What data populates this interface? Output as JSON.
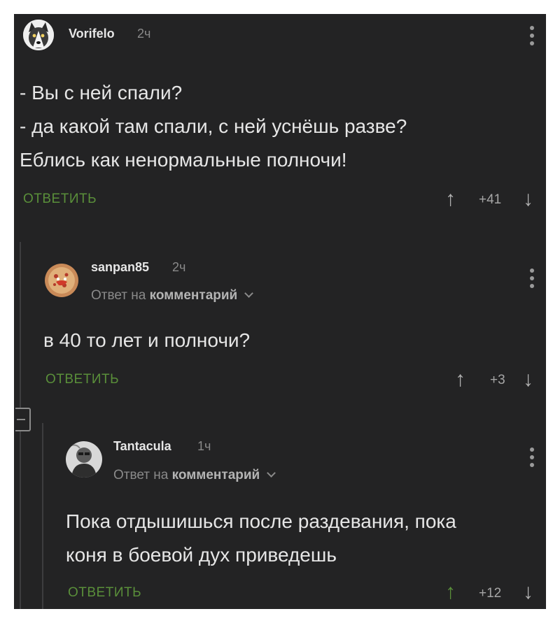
{
  "comments": [
    {
      "username": "Vorifelo",
      "time": "2ч",
      "lines": [
        "- Вы с ней спали?",
        "- да какой там спали, с ней уснёшь разве?",
        "Еблись как ненормальные полночи!"
      ],
      "reply_label": "ОТВЕТИТЬ",
      "score": "+41",
      "avatar_icon": "husky-avatar-icon"
    },
    {
      "username": "sanpan85",
      "time": "2ч",
      "reply_to_prefix": "Ответ на",
      "reply_to_target": "комментарий",
      "lines": [
        "в 40 то лет и полночи?"
      ],
      "reply_label": "ОТВЕТИТЬ",
      "score": "+3",
      "avatar_icon": "pizza-avatar-icon"
    },
    {
      "username": "Tantacula",
      "time": "1ч",
      "reply_to_prefix": "Ответ на",
      "reply_to_target": "комментарий",
      "lines": [
        "Пока отдышишься после раздевания, пока",
        "коня в боевой дух приведешь"
      ],
      "reply_label": "ОТВЕТИТЬ",
      "score": "+12",
      "avatar_icon": "monochrome-portrait-avatar-icon"
    }
  ],
  "colors": {
    "background": "#232324",
    "accent_green": "#5a8f3a",
    "text": "#e6e6e6",
    "muted": "#8a8a8a"
  }
}
